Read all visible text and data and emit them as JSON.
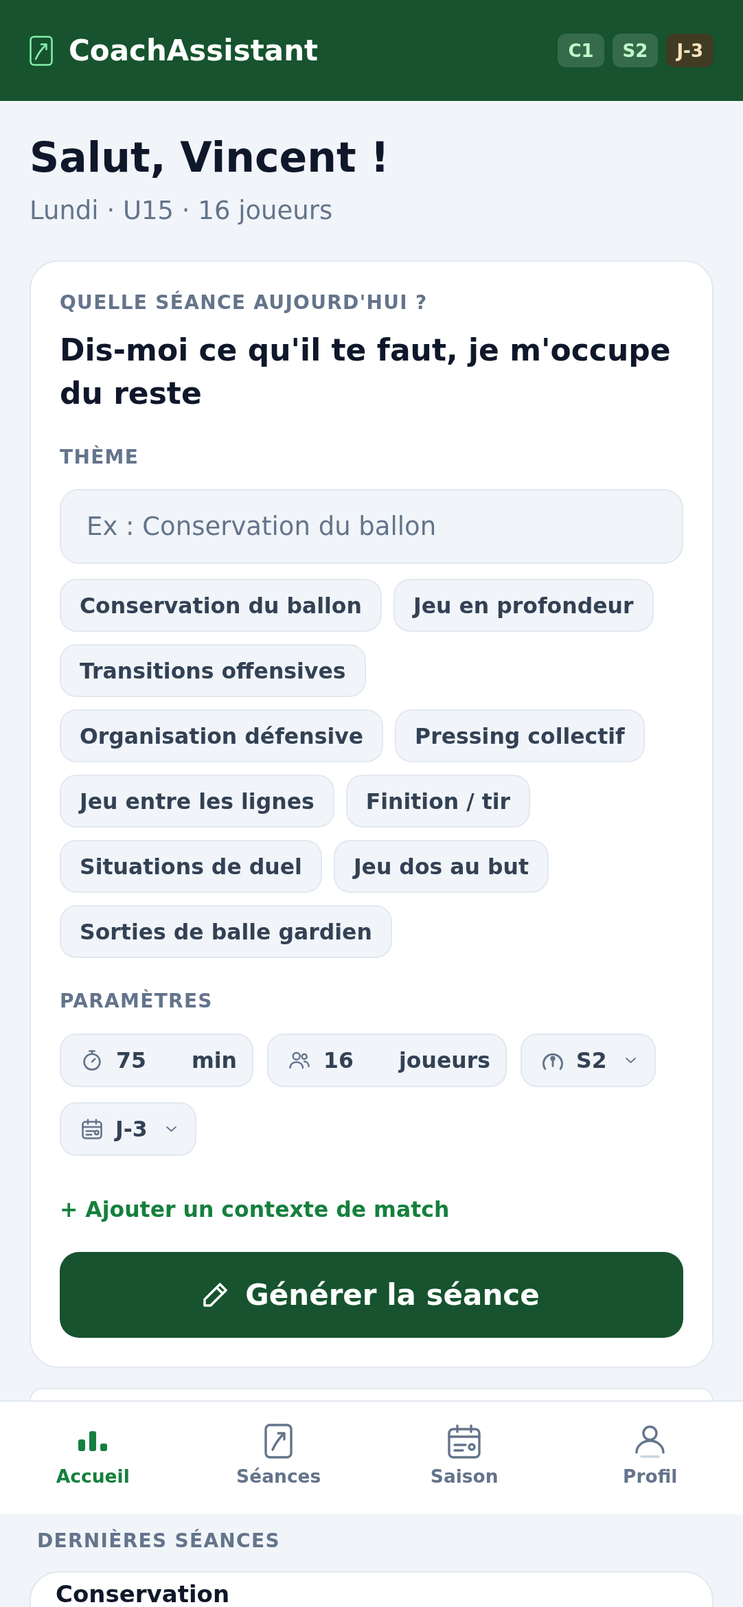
{
  "header": {
    "title": "CoachAssistant",
    "badges": [
      {
        "text": "C1",
        "color": "#356b4b"
      },
      {
        "text": "S2",
        "color": "#356b4b"
      },
      {
        "text": "J-3",
        "color": "#403b22"
      }
    ]
  },
  "greeting": {
    "title": "Salut, Vincent !",
    "subtitle": "Lundi · U15 · 16 joueurs"
  },
  "session_form": {
    "overline": "QUELLE SÉANCE AUJOURD'HUI ?",
    "heading": "Dis-moi ce qu'il te faut, je m'occupe du reste",
    "theme": {
      "label": "THÈME",
      "placeholder": "Ex : Conservation du ballon",
      "chips": [
        {
          "label": "Conservation du ballon",
          "selected": false
        },
        {
          "label": "Jeu en profondeur",
          "selected": false
        },
        {
          "label": "Transitions offensives",
          "selected": false
        },
        {
          "label": "Organisation défensive",
          "selected": false
        },
        {
          "label": "Pressing collectif",
          "selected": false
        },
        {
          "label": "Jeu entre les lignes",
          "selected": false
        },
        {
          "label": "Finition / tir",
          "selected": false
        },
        {
          "label": "Situations de duel",
          "selected": false
        },
        {
          "label": "Jeu dos au but",
          "selected": false
        },
        {
          "label": "Sorties de balle gardien",
          "selected": false
        }
      ]
    },
    "parameters": {
      "label": "PARAMÈTRES",
      "fields": [
        {
          "kind": "number",
          "value": "75",
          "unit": "min"
        },
        {
          "kind": "number",
          "value": "16",
          "unit": "joueurs"
        },
        {
          "kind": "select",
          "value": "S2"
        },
        {
          "kind": "select",
          "value": "J-3"
        }
      ]
    },
    "add_context_link": "+ Ajouter un contexte de match",
    "generate_button": "Générer la séance"
  },
  "bottom_nav": [
    {
      "label": "Accueil",
      "selected": true
    },
    {
      "label": "Séances",
      "selected": false
    },
    {
      "label": "Saison",
      "selected": false
    },
    {
      "label": "Profil",
      "selected": false
    }
  ],
  "recent_sessions": {
    "label": "DERNIÈRES SÉANCES",
    "items": [
      {
        "title": "Conservation"
      }
    ]
  }
}
